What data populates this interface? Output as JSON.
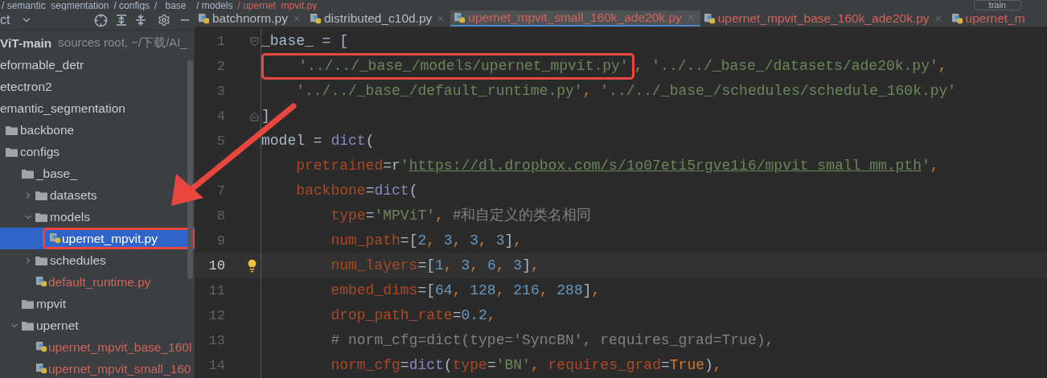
{
  "breadcrumb": [
    "/ semantic_segmentation",
    "/ configs",
    "/ _base_",
    "/ models",
    "/ upernet_mpvit.py"
  ],
  "run_config": {
    "label": "train"
  },
  "project_panel": {
    "title": "ct",
    "tree": [
      {
        "label": "ViT-main",
        "note": "sources root, ~/下载/AI_",
        "bold": true,
        "children": [
          {
            "label": "eformable_detr",
            "bold": false
          },
          {
            "label": "etectron2",
            "bold": false
          },
          {
            "label": "emantic_segmentation",
            "bold": false,
            "children": [
              {
                "label": "backbone",
                "kind": "folder"
              },
              {
                "label": "configs",
                "kind": "folder",
                "children": [
                  {
                    "label": "_base_",
                    "kind": "folder",
                    "children": [
                      {
                        "label": "datasets",
                        "kind": "folder",
                        "expanded": false
                      },
                      {
                        "label": "models",
                        "kind": "folder",
                        "expanded": true,
                        "children": [
                          {
                            "label": "upernet_mpvit.py",
                            "kind": "file",
                            "modified": false,
                            "selected": true,
                            "annotated": true
                          }
                        ]
                      },
                      {
                        "label": "schedules",
                        "kind": "folder",
                        "expanded": false
                      },
                      {
                        "label": "default_runtime.py",
                        "kind": "file",
                        "modified": true,
                        "selected": false
                      }
                    ]
                  },
                  {
                    "label": "mpvit",
                    "kind": "folder"
                  },
                  {
                    "label": "upernet",
                    "kind": "folder",
                    "expanded": true,
                    "children": [
                      {
                        "label": "upernet_mpvit_base_160l",
                        "kind": "file",
                        "modified": true,
                        "selected": false
                      },
                      {
                        "label": "upernet_mpvit_small_160",
                        "kind": "file",
                        "modified": true,
                        "selected": false
                      }
                    ]
                  }
                ]
              }
            ]
          }
        ]
      }
    ]
  },
  "tabs": [
    {
      "label": "batchnorm.py",
      "selected": false,
      "modified": false,
      "closable": true
    },
    {
      "label": "distributed_c10d.py",
      "selected": false,
      "modified": false,
      "closable": true
    },
    {
      "label": "upernet_mpvit_small_160k_ade20k.py",
      "selected": true,
      "modified": true,
      "closable": true
    },
    {
      "label": "upernet_mpvit_base_160k_ade20k.py",
      "selected": false,
      "modified": true,
      "closable": true
    },
    {
      "label": "upernet_m",
      "selected": false,
      "modified": true,
      "closable": false
    }
  ],
  "code_lines": [
    {
      "number": "1",
      "fold_start": true,
      "tokens": [
        {
          "kind": "plain",
          "text": "_base_ = ["
        }
      ]
    },
    {
      "number": "2",
      "tokens": [
        {
          "kind": "string",
          "text": "    '../../_base_/models/upernet_mpvit.py'",
          "annotated": true
        },
        {
          "kind": "punct",
          "text": ", "
        },
        {
          "kind": "string",
          "text": "'../../_base_/datasets/ade20k.py'"
        },
        {
          "kind": "punct",
          "text": ","
        }
      ]
    },
    {
      "number": "3",
      "tokens": [
        {
          "kind": "string",
          "text": "    '../../_base_/default_runtime.py'"
        },
        {
          "kind": "punct",
          "text": ", "
        },
        {
          "kind": "string",
          "text": "'../../_base_/schedules/schedule_160k.py'"
        }
      ]
    },
    {
      "number": "4",
      "fold_end": true,
      "tokens": [
        {
          "kind": "plain",
          "text": "]"
        }
      ]
    },
    {
      "number": "5",
      "tokens": [
        {
          "kind": "plain",
          "text": "model = "
        },
        {
          "kind": "builtin",
          "text": "dict"
        },
        {
          "kind": "plain",
          "text": "("
        }
      ]
    },
    {
      "tokens": [
        {
          "kind": "param",
          "text": "    pretrained"
        },
        {
          "kind": "plain",
          "text": "=r"
        },
        {
          "kind": "string",
          "text": "'"
        },
        {
          "kind": "link",
          "text": "https://dl.dropbox.com/s/1o07eti5rgve1i6/mpvit_small_mm.pth"
        },
        {
          "kind": "string",
          "text": "'"
        },
        {
          "kind": "punct",
          "text": ","
        }
      ]
    },
    {
      "number": "7",
      "tokens": [
        {
          "kind": "param",
          "text": "    backbone"
        },
        {
          "kind": "plain",
          "text": "="
        },
        {
          "kind": "builtin",
          "text": "dict"
        },
        {
          "kind": "plain",
          "text": "("
        }
      ]
    },
    {
      "number": "8",
      "tokens": [
        {
          "kind": "param",
          "text": "        type"
        },
        {
          "kind": "plain",
          "text": "="
        },
        {
          "kind": "string",
          "text": "'MPViT'"
        },
        {
          "kind": "punct",
          "text": ","
        },
        {
          "kind": "comment",
          "text": " #和自定义的类名相同"
        }
      ]
    },
    {
      "number": "9",
      "tokens": [
        {
          "kind": "param",
          "text": "        num_path"
        },
        {
          "kind": "plain",
          "text": "=["
        },
        {
          "kind": "number",
          "text": "2"
        },
        {
          "kind": "punct",
          "text": ", "
        },
        {
          "kind": "number",
          "text": "3"
        },
        {
          "kind": "punct",
          "text": ", "
        },
        {
          "kind": "number",
          "text": "3"
        },
        {
          "kind": "punct",
          "text": ", "
        },
        {
          "kind": "number",
          "text": "3"
        },
        {
          "kind": "plain",
          "text": "]"
        },
        {
          "kind": "punct",
          "text": ","
        }
      ]
    },
    {
      "number": "10",
      "current": true,
      "bulb": true,
      "tokens": [
        {
          "kind": "param",
          "text": "        num_layers"
        },
        {
          "kind": "plain",
          "text": "=["
        },
        {
          "kind": "number",
          "text": "1"
        },
        {
          "kind": "punct",
          "text": ", "
        },
        {
          "kind": "number",
          "text": "3"
        },
        {
          "kind": "punct",
          "text": ", "
        },
        {
          "kind": "number",
          "text": "6"
        },
        {
          "kind": "punct",
          "text": ", "
        },
        {
          "kind": "number",
          "text": "3"
        },
        {
          "kind": "plain",
          "text": "]"
        },
        {
          "kind": "punct",
          "text": ","
        }
      ]
    },
    {
      "number": "11",
      "tokens": [
        {
          "kind": "param",
          "text": "        embed_dims"
        },
        {
          "kind": "plain",
          "text": "=["
        },
        {
          "kind": "number",
          "text": "64"
        },
        {
          "kind": "punct",
          "text": ", "
        },
        {
          "kind": "number",
          "text": "128"
        },
        {
          "kind": "punct",
          "text": ", "
        },
        {
          "kind": "number",
          "text": "216"
        },
        {
          "kind": "punct",
          "text": ", "
        },
        {
          "kind": "number",
          "text": "288"
        },
        {
          "kind": "plain",
          "text": "]"
        },
        {
          "kind": "punct",
          "text": ","
        }
      ]
    },
    {
      "number": "12",
      "tokens": [
        {
          "kind": "param",
          "text": "        drop_path_rate"
        },
        {
          "kind": "plain",
          "text": "="
        },
        {
          "kind": "number",
          "text": "0.2"
        },
        {
          "kind": "punct",
          "text": ","
        }
      ]
    },
    {
      "number": "13",
      "tokens": [
        {
          "kind": "comment",
          "text": "        # norm_cfg=dict(type='SyncBN', requires_grad=True),"
        }
      ]
    },
    {
      "number": "14",
      "tokens": [
        {
          "kind": "param",
          "text": "        norm_cfg"
        },
        {
          "kind": "plain",
          "text": "="
        },
        {
          "kind": "builtin",
          "text": "dict"
        },
        {
          "kind": "plain",
          "text": "("
        },
        {
          "kind": "param",
          "text": "type"
        },
        {
          "kind": "plain",
          "text": "="
        },
        {
          "kind": "string",
          "text": "'BN'"
        },
        {
          "kind": "punct",
          "text": ", "
        },
        {
          "kind": "param",
          "text": "requires_grad"
        },
        {
          "kind": "plain",
          "text": "="
        },
        {
          "kind": "keyword",
          "text": "True"
        },
        {
          "kind": "plain",
          "text": ")"
        },
        {
          "kind": "punct",
          "text": ","
        }
      ]
    }
  ]
}
